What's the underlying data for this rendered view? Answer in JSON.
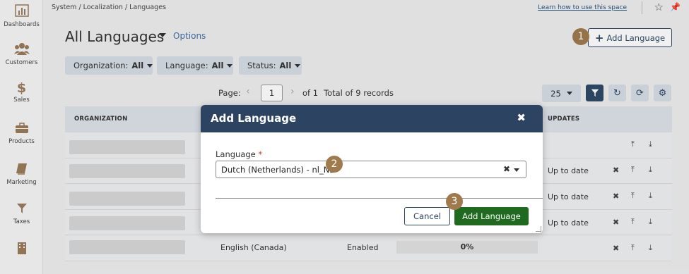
{
  "sidebar": {
    "items": [
      {
        "label": "Dashboards",
        "icon": "bar-chart-icon"
      },
      {
        "label": "Customers",
        "icon": "users-icon"
      },
      {
        "label": "Sales",
        "icon": "dollar-icon"
      },
      {
        "label": "Products",
        "icon": "briefcase-icon"
      },
      {
        "label": "Marketing",
        "icon": "book-icon"
      },
      {
        "label": "Taxes",
        "icon": "funnel-icon"
      },
      {
        "label": "",
        "icon": "building-icon"
      }
    ]
  },
  "topbar": {
    "breadcrumb": "System / Localization / Languages",
    "help_link": "Learn how to use this space"
  },
  "header": {
    "title": "All Languages",
    "options_label": "Options",
    "add_button": "Add Language"
  },
  "filters": [
    {
      "label": "Organization:",
      "value": "All"
    },
    {
      "label": "Language:",
      "value": "All"
    },
    {
      "label": "Status:",
      "value": "All"
    }
  ],
  "pager": {
    "page_label": "Page:",
    "page_value": "1",
    "of_label": "of 1",
    "total_label": "Total of 9 records",
    "per_page": "25"
  },
  "table": {
    "columns": [
      "ORGANIZATION",
      "UPDATES"
    ],
    "rows": [
      {
        "updates": ""
      },
      {
        "updates": "Up to date"
      },
      {
        "updates": "Up to date"
      },
      {
        "updates": "Up to date"
      },
      {
        "language": "English (Canada)",
        "status": "Enabled",
        "progress": "0%"
      }
    ]
  },
  "modal": {
    "title": "Add Language",
    "field_label": "Language",
    "required_mark": "*",
    "selected_value": "Dutch (Netherlands) - nl_NL",
    "cancel_label": "Cancel",
    "confirm_label": "Add Language"
  },
  "steps": [
    "1",
    "2",
    "3"
  ],
  "colors": {
    "primary": "#2c4461",
    "confirm": "#1f6a1f",
    "badge": "#a07a4d",
    "filter_bg": "#d6dde5"
  }
}
